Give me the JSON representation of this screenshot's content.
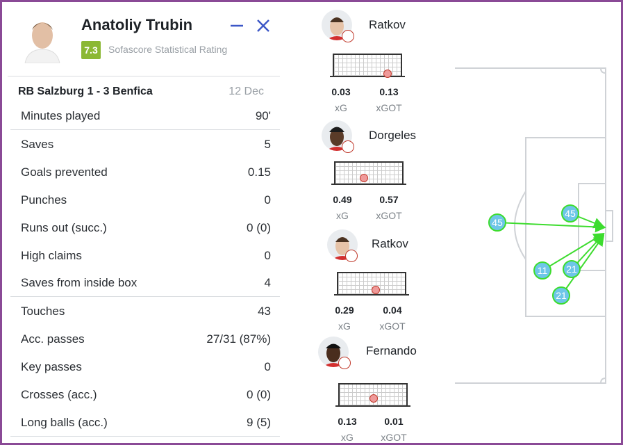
{
  "player": {
    "name": "Anatoliy Trubin",
    "rating": "7.3",
    "rating_label": "Sofascore Statistical Rating"
  },
  "match": {
    "title": "RB Salzburg 1 - 3 Benfica",
    "date": "12 Dec"
  },
  "stats": [
    {
      "label": "Minutes played",
      "value": "90'"
    },
    {
      "label": "Saves",
      "value": "5"
    },
    {
      "label": "Goals prevented",
      "value": "0.15"
    },
    {
      "label": "Punches",
      "value": "0"
    },
    {
      "label": "Runs out (succ.)",
      "value": "0 (0)"
    },
    {
      "label": "High claims",
      "value": "0"
    },
    {
      "label": "Saves from inside box",
      "value": "4"
    },
    {
      "label": "Touches",
      "value": "43"
    },
    {
      "label": "Acc. passes",
      "value": "27/31 (87%)"
    },
    {
      "label": "Key passes",
      "value": "0"
    },
    {
      "label": "Crosses (acc.)",
      "value": "0 (0)"
    },
    {
      "label": "Long balls (acc.)",
      "value": "9 (5)"
    }
  ],
  "shots": [
    {
      "name": "Ratkov",
      "xg": "0.03",
      "xgot": "0.13",
      "xg_label": "xG",
      "xgot_label": "xGOT"
    },
    {
      "name": "Dorgeles",
      "xg": "0.49",
      "xgot": "0.57",
      "xg_label": "xG",
      "xgot_label": "xGOT"
    },
    {
      "name": "Ratkov",
      "xg": "0.29",
      "xgot": "0.04",
      "xg_label": "xG",
      "xgot_label": "xGOT"
    },
    {
      "name": "Fernando",
      "xg": "0.13",
      "xgot": "0.01",
      "xg_label": "xG",
      "xgot_label": "xGOT"
    }
  ],
  "pitch": {
    "shot_numbers": [
      "45",
      "45",
      "11",
      "21",
      "21"
    ],
    "marker_color": "#6ec6e8",
    "arrow_color": "#3ddc2e"
  },
  "colors": {
    "rating": "#8bb834",
    "accent": "#3c57c7",
    "border": "#8a4a96"
  }
}
